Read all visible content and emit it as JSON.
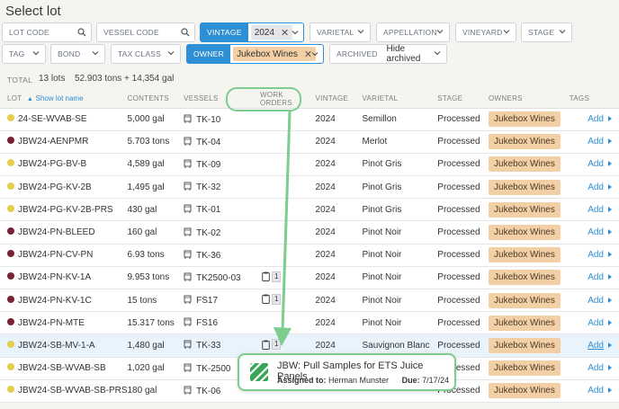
{
  "page": {
    "title": "Select lot"
  },
  "filters": {
    "lot_code": "LOT CODE",
    "vessel_code": "VESSEL CODE",
    "vintage_label": "VINTAGE",
    "vintage_value": "2024",
    "varietal": "VARIETAL",
    "appellation": "APPELLATION",
    "vineyard": "VINEYARD",
    "stage": "STAGE",
    "tag": "TAG",
    "bond": "BOND",
    "tax_class": "TAX CLASS",
    "owner_label": "OWNER",
    "owner_value": "Jukebox Wines",
    "archived_label": "ARCHIVED",
    "archived_value": "Hide archived"
  },
  "summary": {
    "total_label": "TOTAL",
    "lots": "13 lots",
    "amount": "52.903 tons + 14,354 gal"
  },
  "columns": {
    "lot": "LOT",
    "sort_link": "Show lot name",
    "contents": "CONTENTS",
    "vessels": "VESSELS",
    "work_orders": "WORK ORDERS",
    "vintage": "VINTAGE",
    "varietal": "VARIETAL",
    "stage": "STAGE",
    "owners": "OWNERS",
    "tags": "TAGS"
  },
  "rows": [
    {
      "lot": "24-SE-WVAB-SE",
      "dot": "#e3cf4b",
      "contents": "5,000 gal",
      "vessel": "TK-10",
      "wo": "",
      "vintage": "2024",
      "varietal": "Semillon",
      "stage": "Processed",
      "owner": "Jukebox Wines",
      "tag": "Add"
    },
    {
      "lot": "JBW24-AENPMR",
      "dot": "#7a2136",
      "contents": "5.703 tons",
      "vessel": "TK-04",
      "wo": "",
      "vintage": "2024",
      "varietal": "Merlot",
      "stage": "Processed",
      "owner": "Jukebox Wines",
      "tag": "Add"
    },
    {
      "lot": "JBW24-PG-BV-B",
      "dot": "#e3cf4b",
      "contents": "4,589 gal",
      "vessel": "TK-09",
      "wo": "",
      "vintage": "2024",
      "varietal": "Pinot Gris",
      "stage": "Processed",
      "owner": "Jukebox Wines",
      "tag": "Add"
    },
    {
      "lot": "JBW24-PG-KV-2B",
      "dot": "#e3cf4b",
      "contents": "1,495 gal",
      "vessel": "TK-32",
      "wo": "",
      "vintage": "2024",
      "varietal": "Pinot Gris",
      "stage": "Processed",
      "owner": "Jukebox Wines",
      "tag": "Add"
    },
    {
      "lot": "JBW24-PG-KV-2B-PRS",
      "dot": "#e3cf4b",
      "contents": "430 gal",
      "vessel": "TK-01",
      "wo": "",
      "vintage": "2024",
      "varietal": "Pinot Gris",
      "stage": "Processed",
      "owner": "Jukebox Wines",
      "tag": "Add"
    },
    {
      "lot": "JBW24-PN-BLEED",
      "dot": "#7a2136",
      "contents": "160 gal",
      "vessel": "TK-02",
      "wo": "",
      "vintage": "2024",
      "varietal": "Pinot Noir",
      "stage": "Processed",
      "owner": "Jukebox Wines",
      "tag": "Add"
    },
    {
      "lot": "JBW24-PN-CV-PN",
      "dot": "#7a2136",
      "contents": "6.93 tons",
      "vessel": "TK-36",
      "wo": "",
      "vintage": "2024",
      "varietal": "Pinot Noir",
      "stage": "Processed",
      "owner": "Jukebox Wines",
      "tag": "Add"
    },
    {
      "lot": "JBW24-PN-KV-1A",
      "dot": "#7a2136",
      "contents": "9.953 tons",
      "vessel": "TK2500-03",
      "wo": "1",
      "vintage": "2024",
      "varietal": "Pinot Noir",
      "stage": "Processed",
      "owner": "Jukebox Wines",
      "tag": "Add"
    },
    {
      "lot": "JBW24-PN-KV-1C",
      "dot": "#7a2136",
      "contents": "15 tons",
      "vessel": "FS17",
      "wo": "1",
      "vintage": "2024",
      "varietal": "Pinot Noir",
      "stage": "Processed",
      "owner": "Jukebox Wines",
      "tag": "Add"
    },
    {
      "lot": "JBW24-PN-MTE",
      "dot": "#7a2136",
      "contents": "15.317 tons",
      "vessel": "FS16",
      "wo": "",
      "vintage": "2024",
      "varietal": "Pinot Noir",
      "stage": "Processed",
      "owner": "Jukebox Wines",
      "tag": "Add"
    },
    {
      "lot": "JBW24-SB-MV-1-A",
      "dot": "#e3cf4b",
      "contents": "1,480 gal",
      "vessel": "TK-33",
      "wo": "1",
      "vintage": "2024",
      "varietal": "Sauvignon Blanc",
      "stage": "Processed",
      "owner": "Jukebox Wines",
      "tag": "Add",
      "highlight": true
    },
    {
      "lot": "JBW24-SB-WVAB-SB",
      "dot": "#e3cf4b",
      "contents": "1,020 gal",
      "vessel": "TK-2500",
      "wo": "",
      "vintage": "",
      "varietal": "",
      "stage": "Processed",
      "owner": "Jukebox Wines",
      "tag": "Add"
    },
    {
      "lot": "JBW24-SB-WVAB-SB-PRS",
      "dot": "#e3cf4b",
      "contents": "180 gal",
      "vessel": "TK-06",
      "wo": "",
      "vintage": "",
      "varietal": "",
      "stage": "Processed",
      "owner": "Jukebox Wines",
      "tag": "Add"
    }
  ],
  "popup": {
    "title": "JBW: Pull Samples for ETS Juice Panels",
    "assigned_label": "Assigned to:",
    "assigned_value": "Herman Munster",
    "due_label": "Due:",
    "due_value": "7/17/24"
  },
  "colors": {
    "accent": "#2d8fd6",
    "owner_chip": "#f3cfa5",
    "highlight_green": "#7ccd8e"
  }
}
